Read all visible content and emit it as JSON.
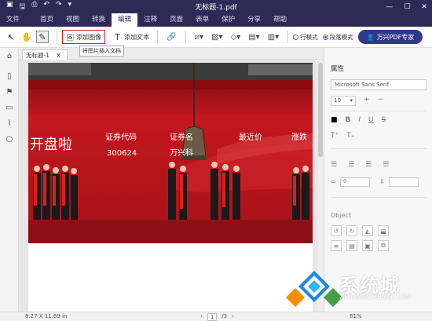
{
  "titlebar": {
    "doc_title": "无标题-1.pdf",
    "quick_icons": [
      "pdf-logo-icon",
      "save-icon",
      "print-icon",
      "undo-icon",
      "redo-icon",
      "dropdown-icon"
    ]
  },
  "menu": {
    "file": "文件",
    "items": [
      "首页",
      "视图",
      "转换",
      "编辑",
      "注释",
      "页面",
      "表单",
      "保护",
      "分享",
      "帮助"
    ],
    "active_index": 3
  },
  "toolbar": {
    "add_image": "添加图像",
    "add_text": "添加文本",
    "tooltip": "将图片插入文档",
    "line_mode": "行模式",
    "paragraph_mode": "段落模式",
    "expert": "万兴PDF专家"
  },
  "tab": {
    "label": "无标题-1"
  },
  "photo": {
    "headline": "开盘啦",
    "label_code": "证券代码",
    "code": "300624",
    "label_name": "证券名",
    "name": "万兴科",
    "label_price": "最近价",
    "label_change": "涨跌"
  },
  "props": {
    "title": "属性",
    "font": "Microsoft Sans Serif",
    "size": "10",
    "spacing_value": "0",
    "object_label": "Object"
  },
  "status": {
    "dims": "8.27 X 11.69 in",
    "page": "1",
    "page_total": "/3",
    "zoom": "81%"
  },
  "watermark": {
    "brand": "系统城",
    "url": "XITONGCHENG.COM"
  },
  "colors": {
    "titlebar": "#2e2a55",
    "accent": "#2d3a8c",
    "highlight": "#e02020",
    "stage_red": "#b1141a"
  }
}
